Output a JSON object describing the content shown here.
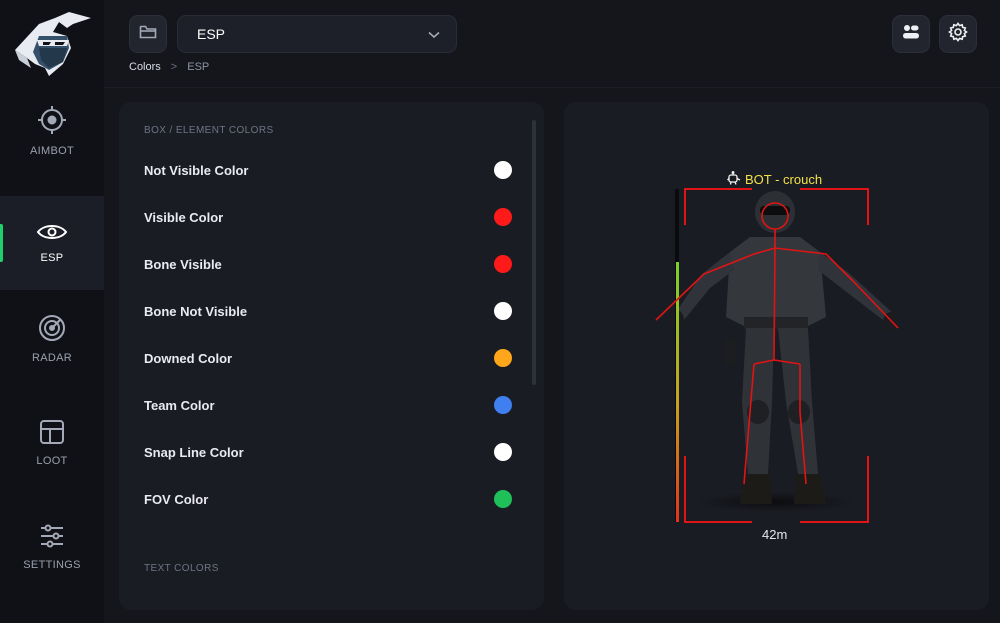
{
  "sidebar": {
    "logo_icon": "ninja-logo-icon",
    "items": [
      {
        "label": "AIMBOT",
        "icon": "crosshair-icon"
      },
      {
        "label": "ESP",
        "icon": "eye-icon",
        "active": true
      },
      {
        "label": "RADAR",
        "icon": "radar-icon"
      },
      {
        "label": "LOOT",
        "icon": "layout-icon"
      },
      {
        "label": "SETTINGS",
        "icon": "sliders-icon"
      }
    ],
    "accent": "#1fd16a"
  },
  "header": {
    "folder_icon": "folder-icon",
    "select_value": "ESP",
    "chevron_icon": "chevron-down-icon",
    "profile_icon": "profiles-icon",
    "settings_icon": "gear-icon",
    "breadcrumb": {
      "root": "Colors",
      "separator": ">",
      "current": "ESP"
    }
  },
  "colors_panel": {
    "box_section_title": "BOX / ELEMENT COLORS",
    "items": [
      {
        "label": "Not Visible Color",
        "color": "#ffffff"
      },
      {
        "label": "Visible Color",
        "color": "#ff1a1a"
      },
      {
        "label": "Bone Visible",
        "color": "#ff1a1a"
      },
      {
        "label": "Bone Not Visible",
        "color": "#ffffff"
      },
      {
        "label": "Downed Color",
        "color": "#ffa61a"
      },
      {
        "label": "Team Color",
        "color": "#3f7ff0"
      },
      {
        "label": "Snap Line Color",
        "color": "#ffffff"
      },
      {
        "label": "FOV Color",
        "color": "#1fbf5a"
      }
    ],
    "text_section_title": "TEXT COLORS"
  },
  "preview": {
    "player_tag": "BOT - crouch",
    "bot_icon": "robot-icon",
    "distance": "42m",
    "box_color": "#e01414",
    "tag_color": "#f3e14a",
    "health_fraction": 0.78
  }
}
